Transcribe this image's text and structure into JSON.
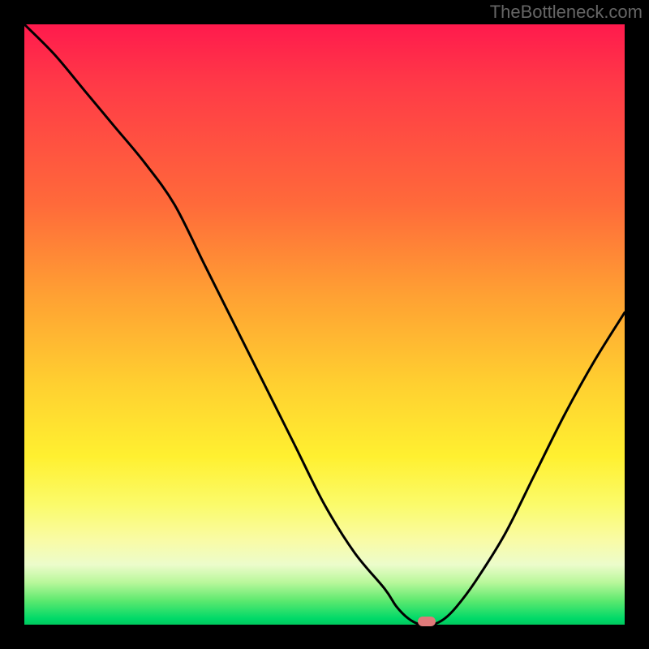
{
  "watermark": "TheBottleneck.com",
  "chart_data": {
    "type": "line",
    "title": "",
    "xlabel": "",
    "ylabel": "",
    "xlim": [
      0,
      100
    ],
    "ylim": [
      0,
      100
    ],
    "x": [
      0,
      5,
      10,
      15,
      20,
      25,
      30,
      35,
      40,
      45,
      50,
      55,
      60,
      62,
      64,
      66,
      68,
      70,
      72,
      75,
      80,
      85,
      90,
      95,
      100
    ],
    "values": [
      100,
      95,
      89,
      83,
      77,
      70,
      60,
      50,
      40,
      30,
      20,
      12,
      6,
      3,
      1,
      0,
      0,
      1,
      3,
      7,
      15,
      25,
      35,
      44,
      52
    ],
    "marker": {
      "x": 67,
      "y": 0
    },
    "background_gradient": {
      "top": "#ff1a4d",
      "mid": "#ffd030",
      "bottom": "#00c95e"
    },
    "colors": {
      "curve": "#000000",
      "marker": "#e07a7a",
      "frame": "#000000"
    }
  }
}
